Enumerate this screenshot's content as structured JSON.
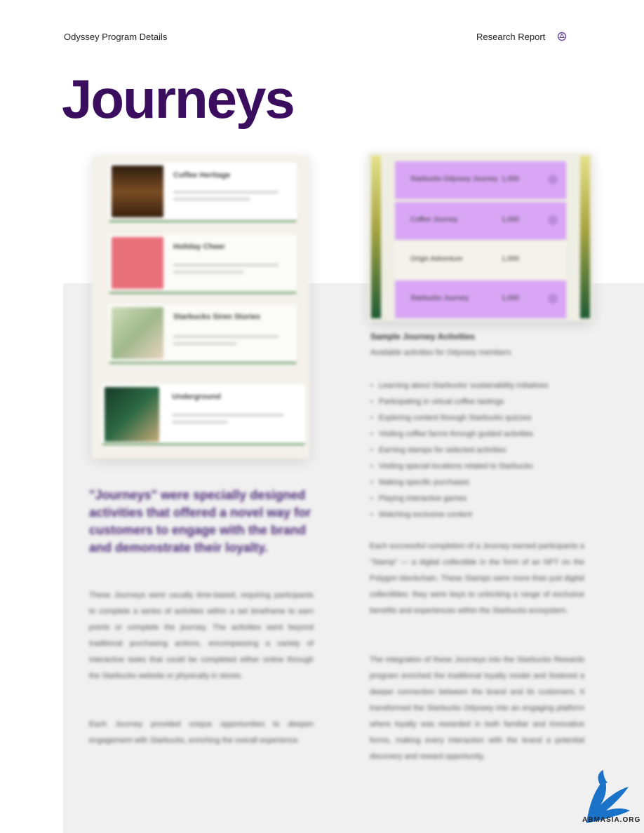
{
  "header": {
    "left": "Odyssey Program Details",
    "right": "Research Report",
    "logo_icon": "nft-logo-icon"
  },
  "page_title": "Journeys",
  "journey_cards": [
    {
      "title": "Coffee Heritage",
      "thumb_color": "#5a3b1e"
    },
    {
      "title": "Holiday Cheer",
      "thumb_color": "#e8707a"
    },
    {
      "title": "Starbucks Siren Stories",
      "thumb_color": "#cfdcb8"
    },
    {
      "title": "Underground",
      "thumb_color": "#1f4a33"
    }
  ],
  "journey_rows": [
    {
      "label": "Starbucks Odyssey Journey",
      "value": "1,000",
      "highlight": true
    },
    {
      "label": "Coffee Journey",
      "value": "1,000",
      "highlight": true
    },
    {
      "label": "Origin Adventure",
      "value": "1,000",
      "highlight": false
    },
    {
      "label": "Starbucks Journey",
      "value": "1,000",
      "highlight": true
    }
  ],
  "caption": {
    "title": "Sample Journey Activities",
    "subtitle": "Available activities for Odyssey members"
  },
  "activities": [
    "Learning about Starbucks' sustainability initiatives",
    "Participating in virtual coffee tastings",
    "Exploring content through Starbucks quizzes",
    "Visiting coffee farms through guided activities",
    "Earning stamps for selected activities",
    "Visiting special locations related to Starbucks",
    "Making specific purchases",
    "Playing interactive games",
    "Watching exclusive content"
  ],
  "quote": "\"Journeys\" were specially designed activities that offered a novel way for customers to engage with the brand and demonstrate their loyalty.",
  "left_paragraphs": [
    "These Journeys were usually time-based, requiring participants to complete a series of activities within a set timeframe to earn points or complete the journey. The activities went beyond traditional purchasing actions, encompassing a variety of interactive tasks that could be completed either online through the Starbucks website or physically in stores.",
    "Each Journey provided unique opportunities to deepen engagement with Starbucks, enriching the overall experience."
  ],
  "right_paragraphs": [
    "Each successful completion of a Journey earned participants a \"Stamp\" — a digital collectible in the form of an NFT on the Polygon blockchain. These Stamps were more than just digital collectibles: they were keys to unlocking a range of exclusive benefits and experiences within the Starbucks ecosystem.",
    "The integration of these Journeys into the Starbucks Rewards program enriched the traditional loyalty model and fostered a deeper connection between the brand and its customers. It transformed the Starbucks Odyssey into an engaging platform where loyalty was rewarded in both familiar and innovative forms, making every interaction with the brand a potential discovery and reward opportunity."
  ],
  "watermark": {
    "text": "ABMASIA.ORG",
    "icon": "dragon-logo-icon",
    "color": "#1a73c8"
  }
}
